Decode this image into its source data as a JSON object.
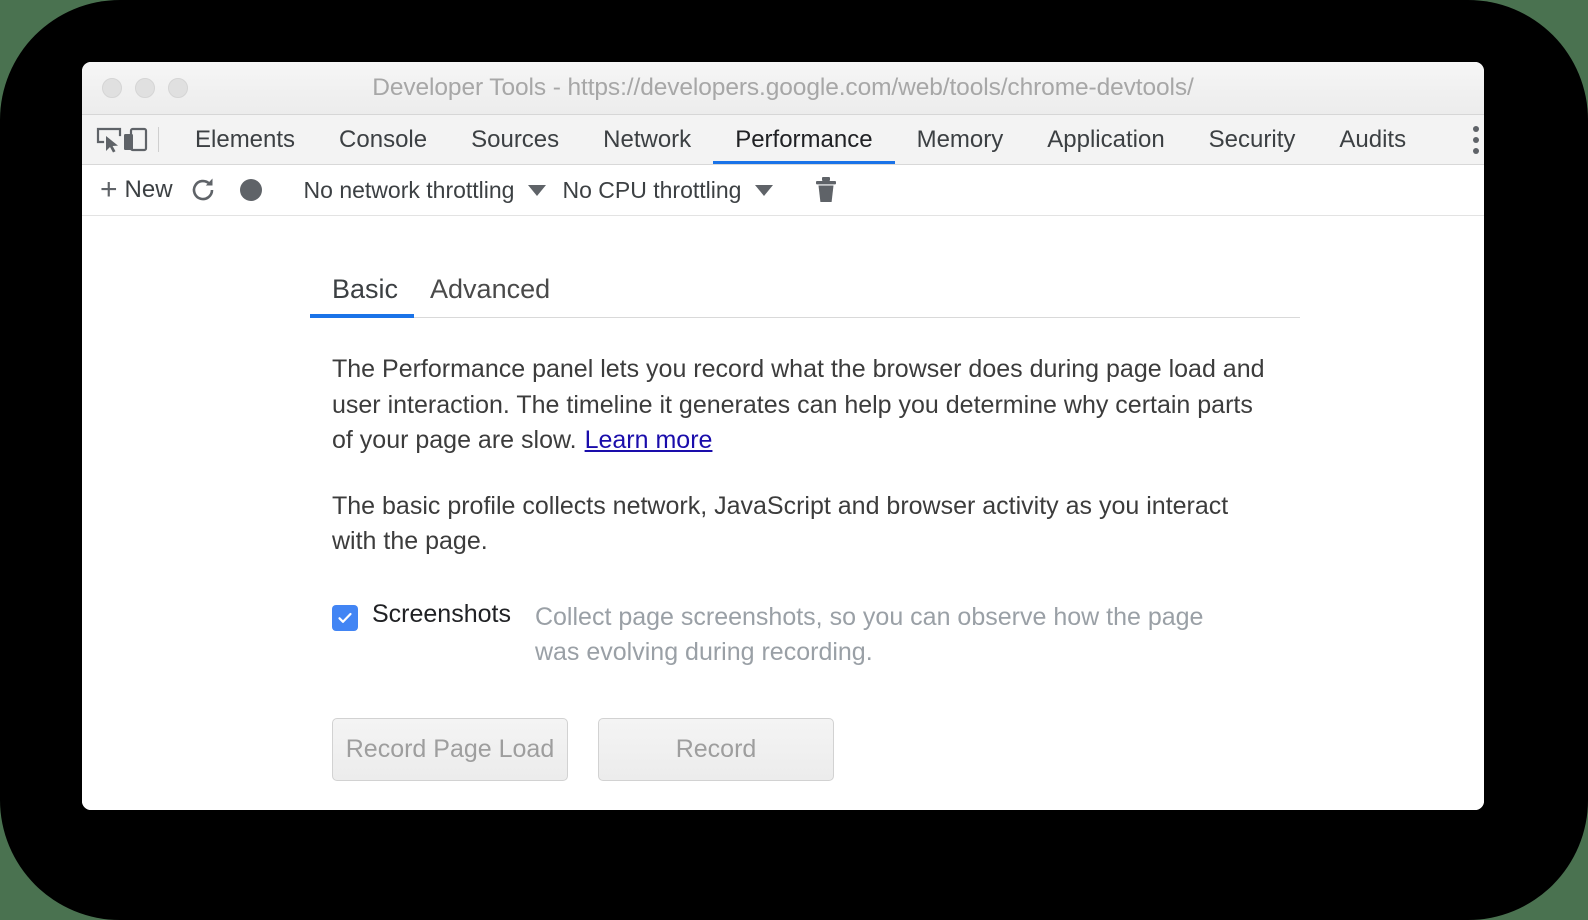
{
  "window": {
    "title": "Developer Tools - https://developers.google.com/web/tools/chrome-devtools/",
    "traffic_lights": [
      "close",
      "minimize",
      "maximize"
    ]
  },
  "tabbar": {
    "icons": [
      {
        "name": "inspect-element-icon"
      },
      {
        "name": "device-toolbar-icon"
      }
    ],
    "tabs": [
      {
        "label": "Elements",
        "active": false
      },
      {
        "label": "Console",
        "active": false
      },
      {
        "label": "Sources",
        "active": false
      },
      {
        "label": "Network",
        "active": false
      },
      {
        "label": "Performance",
        "active": true
      },
      {
        "label": "Memory",
        "active": false
      },
      {
        "label": "Application",
        "active": false
      },
      {
        "label": "Security",
        "active": false
      },
      {
        "label": "Audits",
        "active": false
      }
    ],
    "more_menu": "more-options"
  },
  "toolbar": {
    "new_label": "New",
    "plus_glyph": "+",
    "refresh_icon": "reload-icon",
    "record_icon": "record-circle-icon",
    "network_throttling": "No network throttling",
    "cpu_throttling": "No CPU throttling",
    "clear_icon": "trash-icon"
  },
  "panel": {
    "subtabs": [
      {
        "label": "Basic",
        "active": true
      },
      {
        "label": "Advanced",
        "active": false
      }
    ],
    "paragraph1": "The Performance panel lets you record what the browser does during page load and user interaction. The timeline it generates can help you determine why certain parts of your page are slow.",
    "learn_more": "Learn more",
    "paragraph2": "The basic profile collects network, JavaScript and browser activity as you interact with the page.",
    "screenshots": {
      "checked": true,
      "label": "Screenshots",
      "description": "Collect page screenshots, so you can observe how the page was evolving during recording."
    },
    "buttons": {
      "record_page_load": "Record Page Load",
      "record": "Record"
    }
  },
  "colors": {
    "accent_blue": "#1a73e8",
    "checkbox_blue": "#4285f4",
    "link_blue": "#1a0dab",
    "backdrop_green": "#4a7250",
    "bezel_black": "#000000"
  }
}
